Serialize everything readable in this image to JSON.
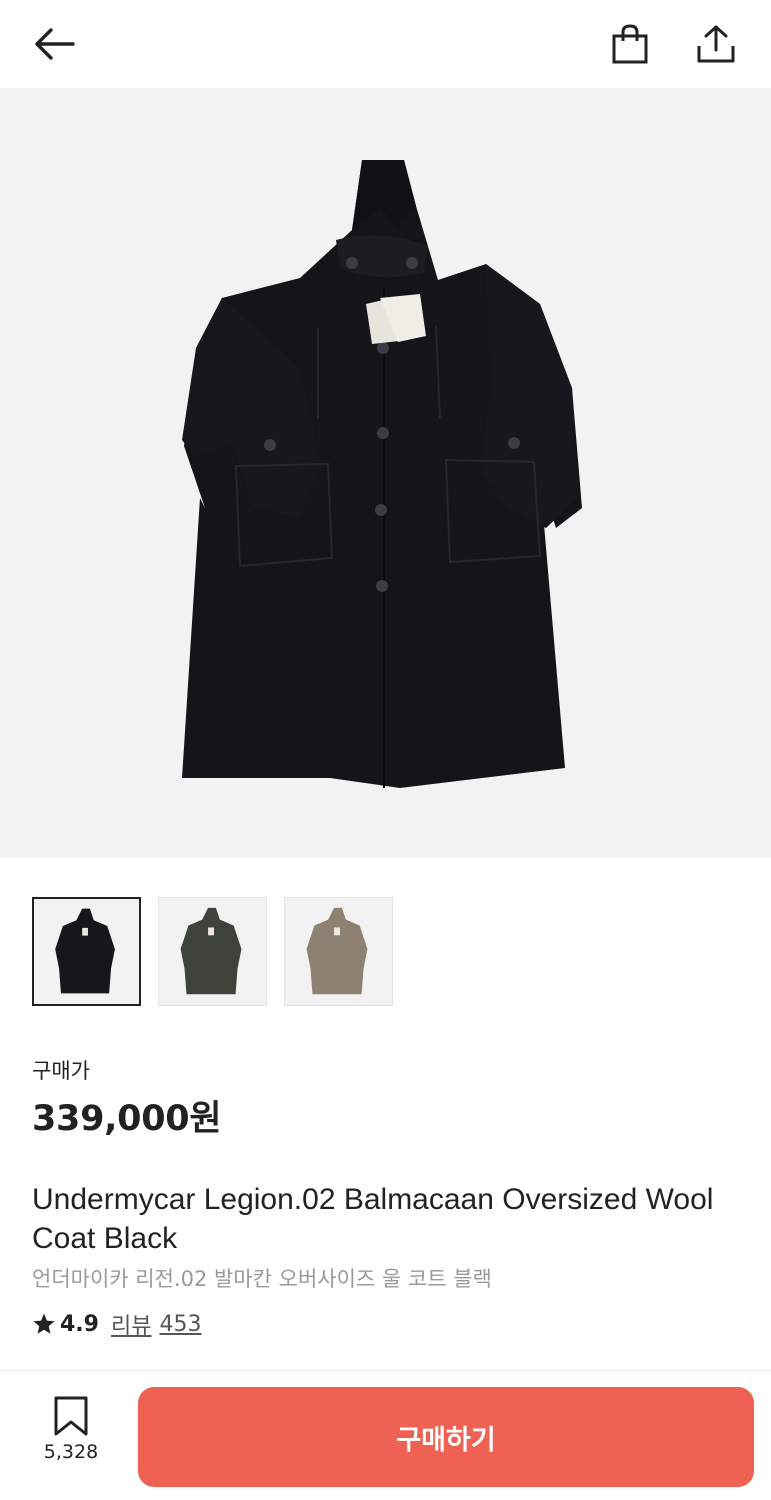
{
  "header": {
    "back_icon": "arrow-left-icon",
    "bag_icon": "shopping-bag-icon",
    "share_icon": "share-icon"
  },
  "product": {
    "main_image": "black-wool-coat-photo",
    "thumbnails": [
      {
        "color_name": "black",
        "swatch": "#15171c"
      },
      {
        "color_name": "olive",
        "swatch": "#3e443c"
      },
      {
        "color_name": "beige",
        "swatch": "#8e8172"
      }
    ],
    "price_label": "구매가",
    "price": "339,000원",
    "title_en": "Undermycar Legion.02 Balmacaan Oversized Wool Coat Black",
    "title_ko": "언더마이카 리전.02 발마칸 오버사이즈 울 코트 블랙",
    "rating": "4.9",
    "review_label": "리뷰",
    "review_count": "453"
  },
  "bottom_bar": {
    "bookmark_count": "5,328",
    "buy_label": "구매하기"
  },
  "colors": {
    "accent": "#ef6253",
    "image_bg": "#f2f2f2"
  }
}
